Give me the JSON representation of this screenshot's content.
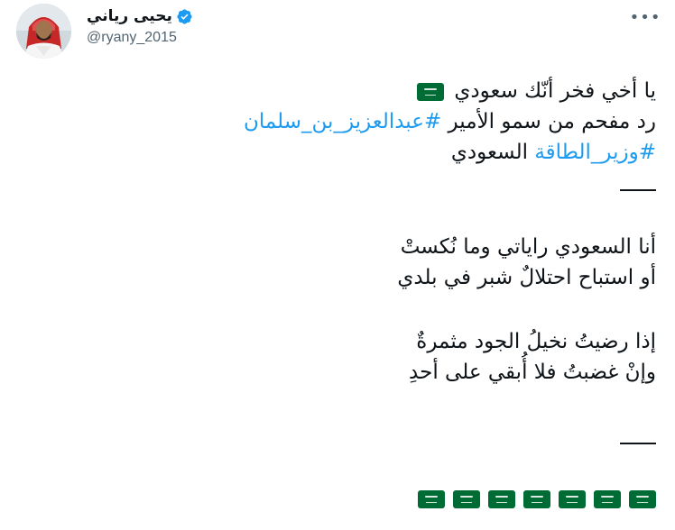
{
  "author": {
    "display_name": "يحيى رياني",
    "handle": "@ryany_2015",
    "verified": true,
    "verified_color": "#1d9bf0"
  },
  "tweet": {
    "line1_text": "يا أخي فخر أنّك سعودي",
    "line2_prefix": "رد مفحم من سمو الأمير ",
    "line2_hashtag": "#عبدالعزيز_بن_سلمان",
    "line3_hashtag": "#وزير_الطاقة",
    "line3_suffix": " السعودي",
    "poem_line1": "أنا السعودي راياتي وما نُكستْ",
    "poem_line2": "أو استباح احتلالٌ شبر في بلدي",
    "poem_line3": "إذا رضيتُ نخيلُ الجود مثمرةٌ",
    "poem_line4": "وإنْ غضبتُ فلا أُبقي على أحدِ",
    "inline_emoji": "saudi-flag",
    "trailing_emoji_count": 7,
    "trailing_emoji": "saudi-flag"
  },
  "colors": {
    "text": "#0f1419",
    "secondary": "#536471",
    "link": "#1d9bf0",
    "flag_green": "#006c35"
  },
  "icons": {
    "more": "more-horizontal-icon",
    "verified": "verified-badge-icon"
  }
}
